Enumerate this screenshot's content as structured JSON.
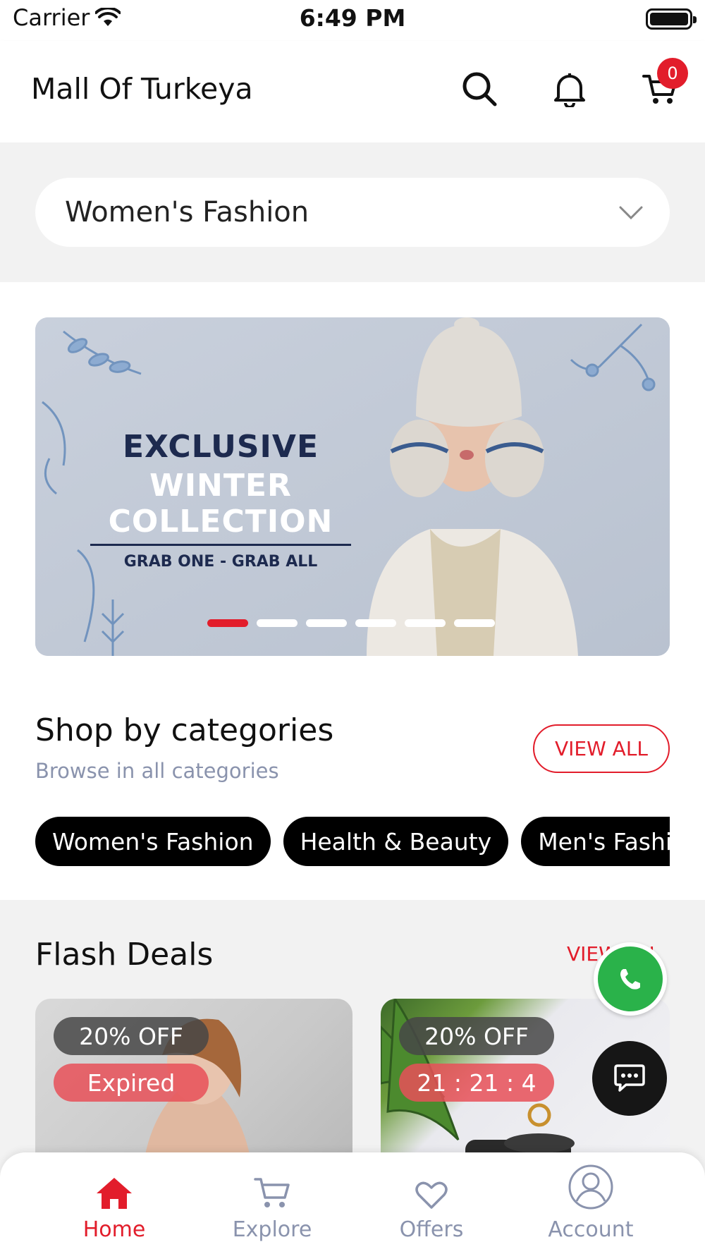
{
  "status_bar": {
    "carrier": "Carrier",
    "time": "6:49 PM"
  },
  "header": {
    "title": "Mall Of Turkeya",
    "cart_count": "0",
    "icons": [
      "search-icon",
      "bell-icon",
      "cart-icon"
    ]
  },
  "category_selector": {
    "selected": "Women's Fashion"
  },
  "banner": {
    "line1": "EXCLUSIVE",
    "line2": "WINTER COLLECTION",
    "line3": "GRAB ONE - GRAB ALL",
    "slide_count": 6,
    "active_slide": 1
  },
  "categories_section": {
    "title": "Shop by categories",
    "subtitle": "Browse in all categories",
    "view_all": "VIEW ALL",
    "chips": [
      "Women's Fashion",
      "Health & Beauty",
      "Men's Fashion"
    ]
  },
  "flash_deals": {
    "title": "Flash Deals",
    "view_all": "VIEW ALL",
    "items": [
      {
        "discount": "20% OFF",
        "status": "Expired"
      },
      {
        "discount": "20% OFF",
        "status": "21 : 21 : 4"
      }
    ]
  },
  "bottom_nav": {
    "items": [
      {
        "label": "Home",
        "icon": "home-icon",
        "active": true
      },
      {
        "label": "Explore",
        "icon": "cart-icon",
        "active": false
      },
      {
        "label": "Offers",
        "icon": "heart-icon",
        "active": false
      },
      {
        "label": "Account",
        "icon": "account-icon",
        "active": false
      }
    ]
  },
  "colors": {
    "accent": "#e21d2b",
    "muted": "#8a93ad",
    "whatsapp": "#2ab24a"
  }
}
